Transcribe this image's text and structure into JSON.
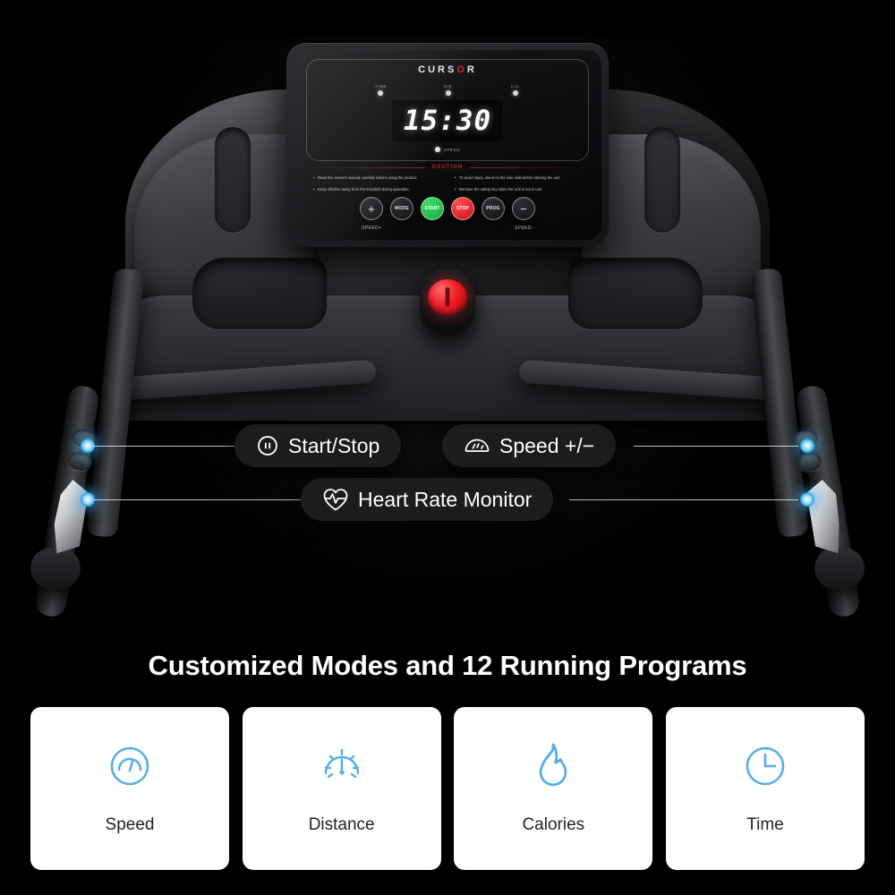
{
  "console": {
    "brand_prefix": "CURS",
    "brand_o": "O",
    "brand_suffix": "R",
    "indicators": [
      {
        "label": "TIME"
      },
      {
        "label": "DIS."
      },
      {
        "label": "CAL"
      }
    ],
    "display_value": "15:30",
    "speed_led_label": "SPEED",
    "caution_title": "CAUTION",
    "caution_left": [
      "Read the owner's manual carefully before using the product.",
      "Keep children away from the treadmill during operation."
    ],
    "caution_right": [
      "To avoid injury, stand on the side rails before starting the unit.",
      "Remove the safety key when the unit is not in use."
    ],
    "buttons": [
      {
        "label": "+",
        "name": "speed-up-button"
      },
      {
        "label": "MODE",
        "name": "mode-button"
      },
      {
        "label": "START",
        "name": "start-button"
      },
      {
        "label": "STOP",
        "name": "stop-button"
      },
      {
        "label": "PROG",
        "name": "prog-button"
      },
      {
        "label": "−",
        "name": "speed-down-button"
      }
    ],
    "speed_up_label": "SPEED+",
    "speed_down_label": "SPEED-"
  },
  "callouts": [
    {
      "label": "Start/Stop",
      "icon": "pause-circle-icon"
    },
    {
      "label": "Speed +/−",
      "icon": "speedometer-icon"
    },
    {
      "label": "Heart Rate Monitor",
      "icon": "heart-pulse-icon"
    }
  ],
  "headline": "Customized Modes and 12 Running Programs",
  "features": [
    {
      "label": "Speed",
      "icon": "speed-gauge-icon"
    },
    {
      "label": "Distance",
      "icon": "odometer-icon"
    },
    {
      "label": "Calories",
      "icon": "flame-icon"
    },
    {
      "label": "Time",
      "icon": "clock-icon"
    }
  ],
  "colors": {
    "accent_blue": "#55aee8",
    "background": "#000000",
    "card_background": "#ffffff",
    "caution_red": "#c2202c",
    "start_green": "#17a83f",
    "stop_red": "#cc0f17"
  }
}
